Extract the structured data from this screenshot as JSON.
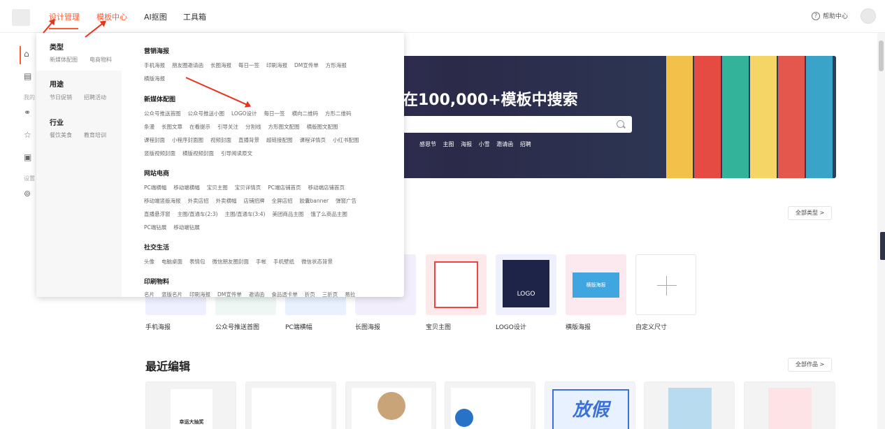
{
  "nav": {
    "items": [
      "设计管理",
      "模板中心",
      "AI抠图",
      "工具箱"
    ],
    "help": "帮助中心"
  },
  "rail": {
    "labels": [
      "我的",
      "设置"
    ]
  },
  "dropdown": {
    "categories": [
      {
        "title": "类型",
        "subs": [
          "新媒体配图",
          "电商物料"
        ]
      },
      {
        "title": "用途",
        "subs": [
          "节日促销",
          "招聘活动"
        ]
      },
      {
        "title": "行业",
        "subs": [
          "餐饮美食",
          "教育培训"
        ]
      }
    ],
    "sections": [
      {
        "title": "营销海报",
        "lines": [
          [
            "手机海报",
            "朋友圈邀请函",
            "长图海报",
            "每日一签",
            "印刷海报",
            "DM宣传单",
            "方形海报"
          ],
          [
            "横版海报"
          ]
        ]
      },
      {
        "title": "新媒体配图",
        "lines": [
          [
            "公众号推送首图",
            "公众号推送小图",
            "LOGO设计",
            "每日一签",
            "横向二维码",
            "方形二维码"
          ],
          [
            "条漫",
            "长图文章",
            "在看提示",
            "引导关注",
            "分割线",
            "方形图文配图",
            "横版图文配图"
          ],
          [
            "课程封面",
            "小程序封面图",
            "视频封面",
            "直播背景",
            "超链接配图",
            "课程详情页",
            "小红书配图"
          ],
          [
            "竖版视频封面",
            "横版视频封面",
            "引导阅读原文"
          ]
        ]
      },
      {
        "title": "网站电商",
        "lines": [
          [
            "PC端横幅",
            "移动端横幅",
            "宝贝主图",
            "宝贝详情页",
            "PC端店铺首页",
            "移动端店铺首页"
          ],
          [
            "移动端竖版海报",
            "外卖店招",
            "外卖横幅",
            "店铺招牌",
            "全屏店招",
            "胶囊banner",
            "弹窗广告"
          ],
          [
            "直播悬浮窗",
            "主图/直通车(2:3)",
            "主图/直通车(3:4)",
            "美团商品主图",
            "饿了么商品主图"
          ],
          [
            "PC端钻展",
            "移动端钻展"
          ]
        ]
      },
      {
        "title": "社交生活",
        "lines": [
          [
            "头像",
            "电脑桌面",
            "表情包",
            "微信朋友圈封面",
            "手帐",
            "手机壁纸",
            "微信状态背景"
          ]
        ]
      },
      {
        "title": "印刷物料",
        "lines": [
          [
            "名片",
            "竖版名片",
            "印刷海报",
            "DM宣传单",
            "邀请函",
            "食品透卡单",
            "折页",
            "三折页",
            "易拉"
          ]
        ]
      }
    ]
  },
  "banner": {
    "title": "在100,000+模板中搜索",
    "tags": [
      "感恩节",
      "主图",
      "海报",
      "小雪",
      "邀请函",
      "招聘"
    ]
  },
  "types": {
    "all_label": "全部类型 >",
    "items": [
      "手机海报",
      "公众号推送首图",
      "PC端横幅",
      "长图海报",
      "宝贝主图",
      "LOGO设计",
      "横版海报",
      "自定义尺寸"
    ]
  },
  "thumbs": {
    "logo_text": "LOGO",
    "poster_text": "横版海报"
  },
  "recent": {
    "title": "最近编辑",
    "all_label": "全部作品 >",
    "card1_text": "幸运大抽奖",
    "card5_text": "放假"
  },
  "colors": {
    "accent": "#ff5a36",
    "arrow": "#e8331f"
  }
}
